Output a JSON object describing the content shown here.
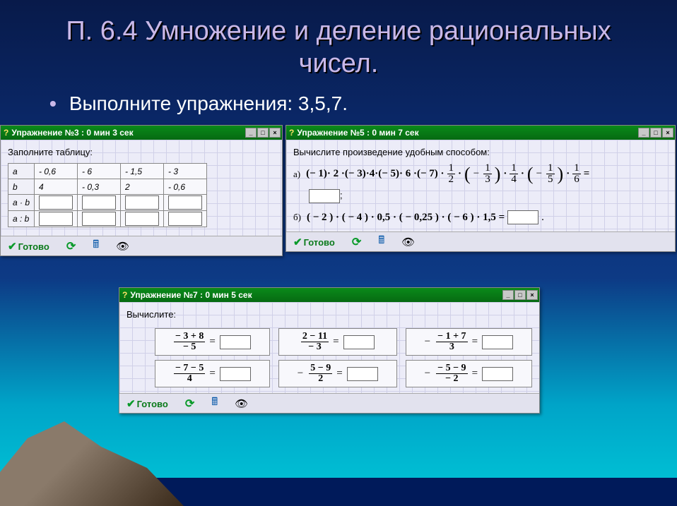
{
  "slide": {
    "title": "П. 6.4 Умножение и деление рациональных чисел.",
    "bullet": "Выполните упражнения: 3,5,7."
  },
  "win3": {
    "title": "Упражнение №3 : 0 мин  3 сек",
    "prompt": "Заполните таблицу:",
    "rows": {
      "r1": {
        "h": "a",
        "c": [
          "- 0,6",
          "- 6",
          "- 1,5",
          "- 3"
        ]
      },
      "r2": {
        "h": "b",
        "c": [
          "4",
          "- 0,3",
          "2",
          "- 0,6"
        ]
      },
      "r3": {
        "h": "a · b"
      },
      "r4": {
        "h": "a : b"
      }
    }
  },
  "win5": {
    "title": "Упражнение №5 : 0 мин  7 сек",
    "prompt": "Вычислите произведение удобным способом:",
    "a_label": "а)",
    "a_expr": "(− 1)· 2 ·(− 3)·4·(− 5)· 6 ·(− 7) ·",
    "a_fracs": [
      {
        "n": "1",
        "d": "2"
      },
      {
        "neg": true,
        "n": "1",
        "d": "3"
      },
      {
        "n": "1",
        "d": "4"
      },
      {
        "neg": true,
        "n": "1",
        "d": "5"
      },
      {
        "n": "1",
        "d": "6"
      }
    ],
    "b_label": "б)",
    "b_expr": "( − 2 ) · ( − 4 ) · 0,5 · ( − 0,25 ) · ( − 6 ) · 1,5  ="
  },
  "win7": {
    "title": "Упражнение №7 : 0 мин  5 сек",
    "prompt": "Вычислите:",
    "cells": [
      {
        "neg": "",
        "n": "− 3 + 8",
        "d": "− 5"
      },
      {
        "neg": "",
        "n": "2 − 11",
        "d": "− 3"
      },
      {
        "neg": "−",
        "n": "− 1 + 7",
        "d": "3"
      },
      {
        "neg": "",
        "n": "− 7 − 5",
        "d": "4"
      },
      {
        "neg": "−",
        "n": "5 − 9",
        "d": "2"
      },
      {
        "neg": "−",
        "n": "− 5 − 9",
        "d": "− 2"
      }
    ]
  },
  "footer": {
    "ready": "Готово"
  }
}
